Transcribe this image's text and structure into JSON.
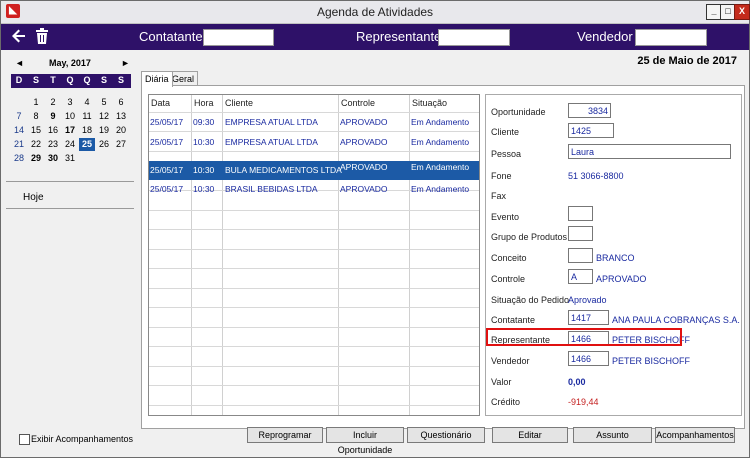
{
  "window": {
    "title": "Agenda de Atividades",
    "min": "_",
    "max": "□",
    "close": "X"
  },
  "toolbar": {
    "back_icon": "back-arrow-icon",
    "trash_icon": "trash-icon",
    "contatante_label": "Contatante",
    "representante_label": "Representante",
    "vendedor_label": "Vendedor"
  },
  "date_header": "25 de Maio de 2017",
  "calendar": {
    "month_label": "May, 2017",
    "prev": "◄",
    "next": "►",
    "weekdays": [
      "D",
      "S",
      "T",
      "Q",
      "Q",
      "S",
      "S"
    ],
    "weeks": [
      [
        "",
        "1",
        "2",
        "3",
        "4",
        "5",
        "6"
      ],
      [
        "7",
        "8",
        "9",
        "10",
        "11",
        "12",
        "13"
      ],
      [
        "14",
        "15",
        "16",
        "17",
        "18",
        "19",
        "20"
      ],
      [
        "21",
        "22",
        "23",
        "24",
        "25",
        "26",
        "27"
      ],
      [
        "28",
        "29",
        "30",
        "31",
        "",
        "",
        ""
      ]
    ],
    "selected": "25"
  },
  "sidebar": {
    "hoje": "Hoje",
    "exibir_label": "Exibir Acompanhamentos"
  },
  "tabs": [
    "Diária",
    "Geral"
  ],
  "grid": {
    "columns": [
      "Data",
      "Hora",
      "Cliente",
      "Controle",
      "Situação"
    ],
    "rows": [
      [
        "25/05/17",
        "09:30",
        "EMPRESA ATUAL LTDA",
        "APROVADO",
        "Em Andamento"
      ],
      [
        "25/05/17",
        "10:30",
        "EMPRESA ATUAL LTDA",
        "APROVADO",
        "Em Andamento"
      ],
      [
        "25/05/17",
        "10:30",
        "BULA MEDICAMENTOS LTDA",
        "APROVADO",
        "Em Andamento"
      ],
      [
        "25/05/17",
        "10:30",
        "BRASIL BEBIDAS LTDA",
        "APROVADO",
        "Em Andamento"
      ]
    ],
    "selected_row": 2
  },
  "form": {
    "oportunidade": {
      "label": "Oportunidade",
      "value": "3834"
    },
    "cliente": {
      "label": "Cliente",
      "value": "1425"
    },
    "pessoa": {
      "label": "Pessoa",
      "value": "Laura"
    },
    "fone": {
      "label": "Fone",
      "value": "51 3066-8800"
    },
    "fax": {
      "label": "Fax"
    },
    "evento": {
      "label": "Evento"
    },
    "grupo": {
      "label": "Grupo de Produtos"
    },
    "conceito": {
      "label": "Conceito",
      "value": "BRANCO"
    },
    "controle": {
      "label": "Controle",
      "code": "A",
      "value": "APROVADO"
    },
    "situacao": {
      "label": "Situação do Pedido",
      "value": "Aprovado"
    },
    "contatante": {
      "label": "Contatante",
      "code": "1417",
      "value": "ANA PAULA COBRANÇAS S.A."
    },
    "representante": {
      "label": "Representante",
      "code": "1466",
      "value": "PETER BISCHOFF"
    },
    "vendedor": {
      "label": "Vendedor",
      "code": "1466",
      "value": "PETER BISCHOFF"
    },
    "valor": {
      "label": "Valor",
      "value": "0,00"
    },
    "credito": {
      "label": "Crédito",
      "value": "-919,44"
    }
  },
  "buttons": [
    {
      "name": "reprogramar",
      "label": "Reprogramar"
    },
    {
      "name": "incluir",
      "label": "Incluir Oportunidade"
    },
    {
      "name": "questionario",
      "label": "Questionário"
    },
    {
      "name": "editar",
      "label": "Editar"
    },
    {
      "name": "assunto",
      "label": "Assunto"
    },
    {
      "name": "acompanhamentos",
      "label": "Acompanhamentos"
    }
  ],
  "colors": {
    "toolbar_bg": "#2e1168",
    "selection": "#1c5aa6",
    "value_text": "#1a2aa0",
    "credit_text": "#c42020",
    "highlight_border": "#e01010"
  }
}
